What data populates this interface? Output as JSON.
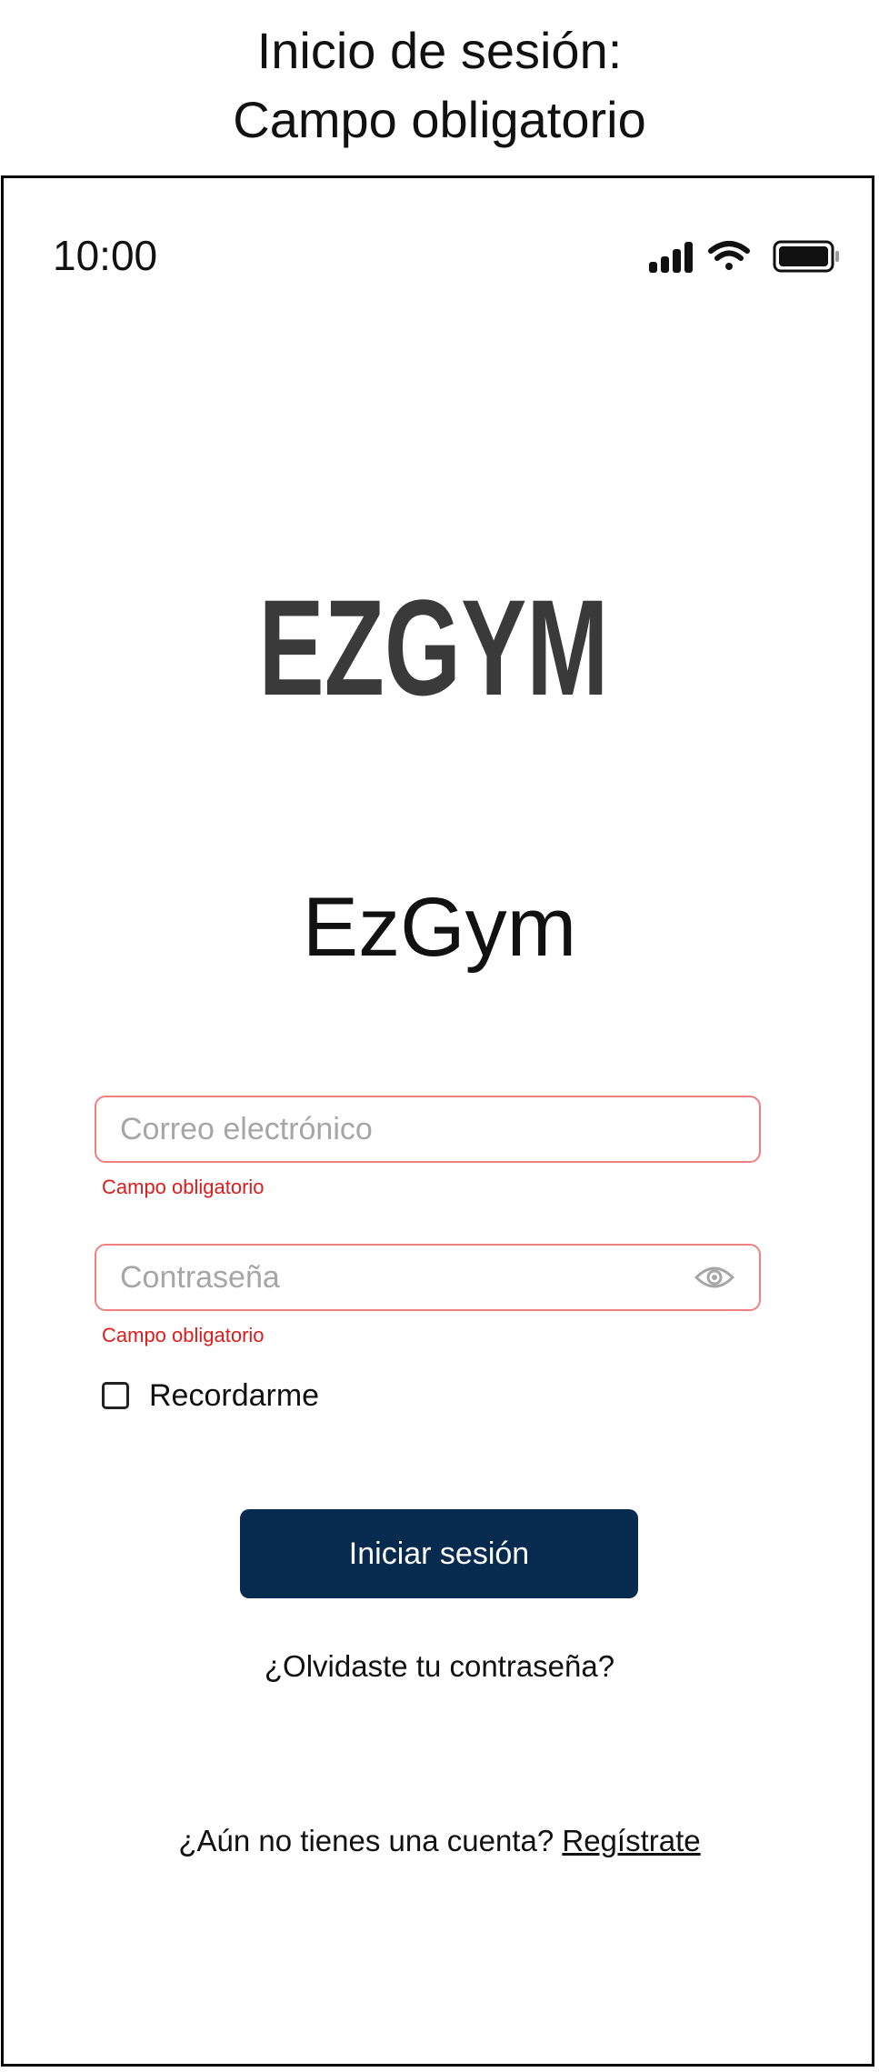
{
  "caption": {
    "line1": "Inicio de sesión:",
    "line2": "Campo obligatorio"
  },
  "status_bar": {
    "time": "10:00",
    "icons": [
      "signal-icon",
      "wifi-icon",
      "battery-icon"
    ]
  },
  "logo": {
    "text": "EZGYM",
    "color": "#3a3a3a"
  },
  "app_name": "EzGym",
  "form": {
    "email": {
      "placeholder": "Correo electrónico",
      "value": "",
      "error": "Campo obligatorio"
    },
    "password": {
      "placeholder": "Contraseña",
      "value": "",
      "error": "Campo obligatorio",
      "toggle_icon": "eye-icon"
    },
    "remember": {
      "label": "Recordarme",
      "checked": false
    },
    "submit_label": "Iniciar sesión",
    "forgot_label": "¿Olvidaste tu contraseña?"
  },
  "signup": {
    "prompt": "¿Aún no tienes una cuenta?",
    "link": "Regístrate"
  },
  "colors": {
    "primary_button": "#062b4f",
    "error": "#e01b1b",
    "error_border": "#f08080",
    "placeholder": "#a6a6a6"
  }
}
